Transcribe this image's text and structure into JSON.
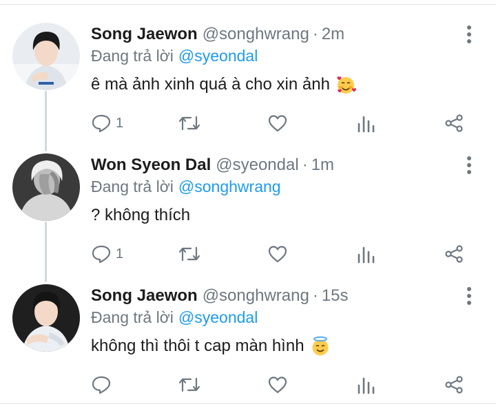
{
  "reply_prefix": "Đang trả lời",
  "tweets": [
    {
      "name": "Song Jaewon",
      "handle": "@songhwrang",
      "separator": "·",
      "time": "2m",
      "replying_to": "@syeondal",
      "text": "ê mà ảnh xinh quá à cho xin ảnh",
      "emoji": "smiling-face-with-hearts-icon",
      "reply_count": "1"
    },
    {
      "name": "Won Syeon Dal",
      "handle": "@syeondal",
      "separator": "·",
      "time": "1m",
      "replying_to": "@songhwrang",
      "text": "? không thích",
      "emoji": "",
      "reply_count": "1"
    },
    {
      "name": "Song Jaewon",
      "handle": "@songhwrang",
      "separator": "·",
      "time": "15s",
      "replying_to": "@syeondal",
      "text": "không thì thôi t cap màn hình",
      "emoji": "smiling-face-with-halo-icon",
      "reply_count": ""
    }
  ],
  "colors": {
    "mention": "#1d9bf0",
    "secondary_text": "#6e7780",
    "thread_line": "#cfd9de"
  }
}
